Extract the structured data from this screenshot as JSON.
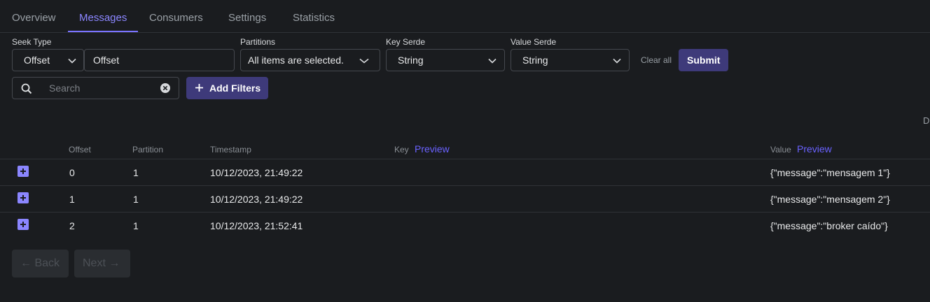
{
  "tabs": [
    {
      "label": "Overview"
    },
    {
      "label": "Messages",
      "active": true
    },
    {
      "label": "Consumers"
    },
    {
      "label": "Settings"
    },
    {
      "label": "Statistics"
    }
  ],
  "filters": {
    "seek_type_label": "Seek Type",
    "seek_type_value": "Offset",
    "offset_value": "Offset",
    "partitions_label": "Partitions",
    "partitions_value": "All items are selected.",
    "key_serde_label": "Key Serde",
    "key_serde_value": "String",
    "value_serde_label": "Value Serde",
    "value_serde_value": "String",
    "clear_all": "Clear all",
    "submit": "Submit",
    "search_placeholder": "Search",
    "add_filters": "Add Filters"
  },
  "edge_text": "D",
  "table": {
    "headers": {
      "offset": "Offset",
      "partition": "Partition",
      "timestamp": "Timestamp",
      "key": "Key",
      "key_preview": "Preview",
      "value": "Value",
      "value_preview": "Preview"
    },
    "rows": [
      {
        "offset": "0",
        "partition": "1",
        "timestamp": "10/12/2023, 21:49:22",
        "key": "",
        "value": "{\"message\":\"mensagem 1\"}"
      },
      {
        "offset": "1",
        "partition": "1",
        "timestamp": "10/12/2023, 21:49:22",
        "key": "",
        "value": "{\"message\":\"mensagem 2\"}"
      },
      {
        "offset": "2",
        "partition": "1",
        "timestamp": "10/12/2023, 21:52:41",
        "key": "",
        "value": "{\"message\":\"broker caído\"}"
      }
    ]
  },
  "pagination": {
    "back": "← Back",
    "next": "Next →"
  },
  "colors": {
    "background": "#1a1c1f",
    "accent": "#7a73ff",
    "primary_button": "#3e3a7a",
    "preview_link": "#6a62ff"
  }
}
